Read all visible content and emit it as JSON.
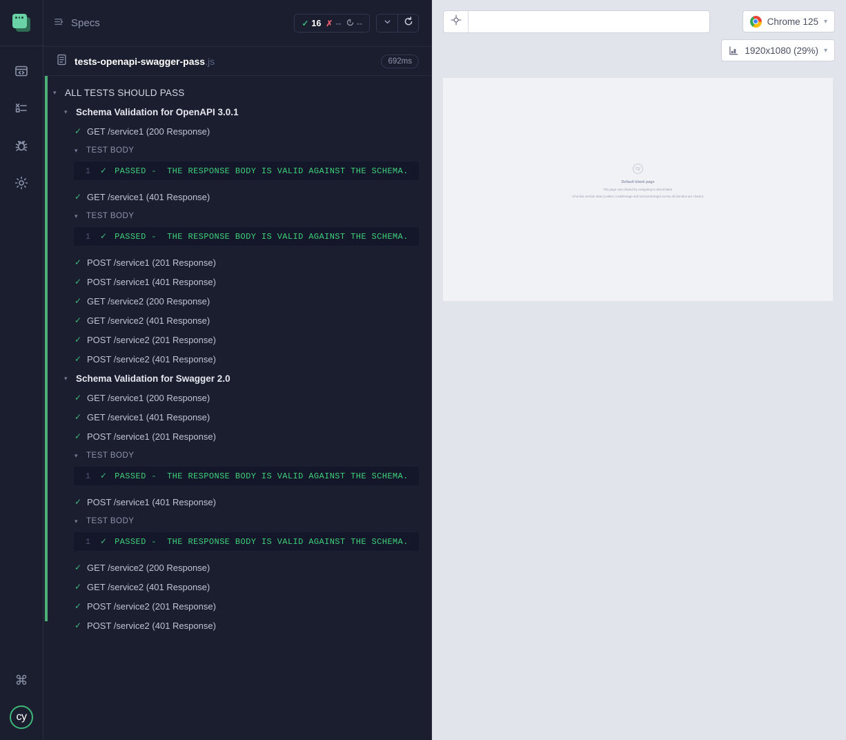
{
  "rail": {
    "project_logo": "cypress-project-logo",
    "items": [
      {
        "name": "specs",
        "icon": "code-window-icon"
      },
      {
        "name": "runs",
        "icon": "runs-list-icon"
      },
      {
        "name": "debug",
        "icon": "bug-icon"
      },
      {
        "name": "settings",
        "icon": "gear-icon"
      }
    ],
    "bottom": [
      {
        "name": "keyboard-shortcuts",
        "icon": "command-key-icon",
        "glyph": "⌘"
      }
    ],
    "cy_badge_label": "cy"
  },
  "reporter": {
    "header": {
      "title": "Specs",
      "stats": {
        "passed": "16",
        "failed": "--",
        "pending": "--"
      },
      "collapse_button": "collapse-all",
      "rerun_button": "rerun-specs"
    },
    "spec": {
      "name": "tests-openapi-swagger-pass",
      "extension": ".js",
      "duration": "692ms"
    },
    "suite_root": "ALL TESTS SHOULD PASS",
    "test_body_label": "TEST BODY",
    "code_line_number": "1",
    "code_text": "PASSED -  THE RESPONSE BODY IS VALID AGAINST THE SCHEMA.",
    "groups": [
      {
        "title": "Schema Validation for OpenAPI 3.0.1",
        "tests": [
          {
            "label": "GET /service1 (200 Response)",
            "has_body": true
          },
          {
            "label": "GET /service1 (401 Response)",
            "has_body": true
          },
          {
            "label": "POST /service1 (201 Response)",
            "has_body": false
          },
          {
            "label": "POST /service1 (401 Response)",
            "has_body": false
          },
          {
            "label": "GET /service2 (200 Response)",
            "has_body": false
          },
          {
            "label": "GET /service2 (401 Response)",
            "has_body": false
          },
          {
            "label": "POST /service2 (201 Response)",
            "has_body": false
          },
          {
            "label": "POST /service2 (401 Response)",
            "has_body": false
          }
        ]
      },
      {
        "title": "Schema Validation for Swagger 2.0",
        "tests": [
          {
            "label": "GET /service1 (200 Response)",
            "has_body": false
          },
          {
            "label": "GET /service1 (401 Response)",
            "has_body": false
          },
          {
            "label": "POST /service1 (201 Response)",
            "has_body": true
          },
          {
            "label": "POST /service1 (401 Response)",
            "has_body": true
          },
          {
            "label": "GET /service2 (200 Response)",
            "has_body": false
          },
          {
            "label": "GET /service2 (401 Response)",
            "has_body": false
          },
          {
            "label": "POST /service2 (201 Response)",
            "has_body": false
          },
          {
            "label": "POST /service2 (401 Response)",
            "has_body": false
          }
        ]
      }
    ]
  },
  "preview": {
    "url_value": "",
    "url_placeholder": "",
    "selector_playground": "selector-playground",
    "browser": "Chrome 125",
    "viewport": "1920x1080 (29%)",
    "aut": {
      "logo": "cy",
      "title": "Default blank page",
      "line1": "This page was cleared by navigating to about:blank.",
      "line2": "All active session data (cookies, localStorage and sessionStorage) across all domains are cleared."
    }
  },
  "colors": {
    "app_bg": "#1b1e2e",
    "pass_green": "#3fba7d",
    "fail_red": "#e45c6b",
    "preview_bg": "#e2e4eb",
    "aut_bg": "#f1f2f6"
  }
}
